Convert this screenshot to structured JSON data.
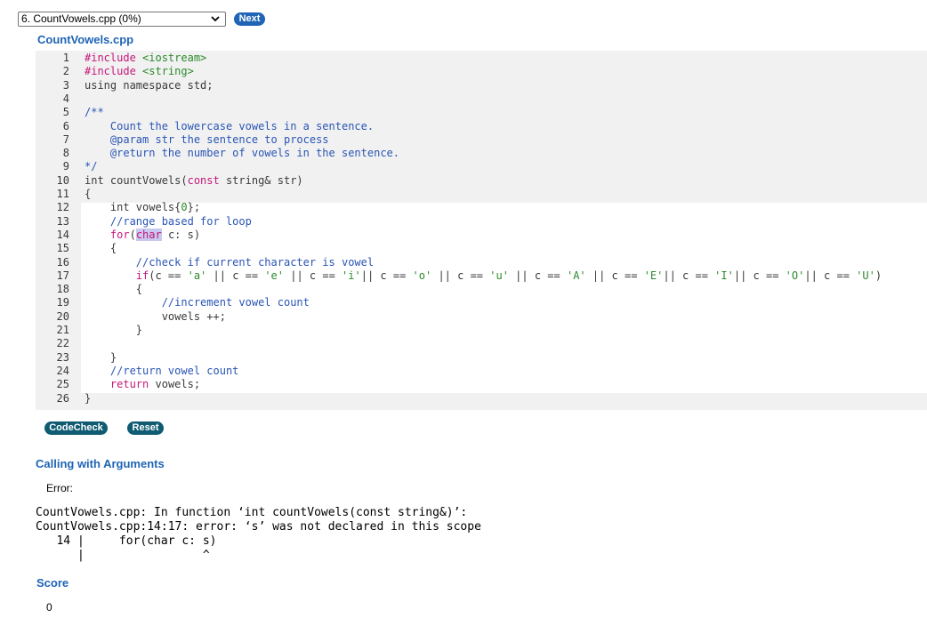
{
  "toolbar": {
    "file_select_value": "6. CountVowels.cpp (0%)",
    "next_label": "Next"
  },
  "editor": {
    "filename": "CountVowels.cpp",
    "lines": [
      {
        "n": "1",
        "text": "#include <iostream>"
      },
      {
        "n": "2",
        "text": "#include <string>"
      },
      {
        "n": "3",
        "text": "using namespace std;"
      },
      {
        "n": "4",
        "text": ""
      },
      {
        "n": "5",
        "text": "/**"
      },
      {
        "n": "6",
        "text": "    Count the lowercase vowels in a sentence."
      },
      {
        "n": "7",
        "text": "    @param str the sentence to process"
      },
      {
        "n": "8",
        "text": "    @return the number of vowels in the sentence."
      },
      {
        "n": "9",
        "text": "*/"
      },
      {
        "n": "10",
        "text": "int countVowels(const string& str)"
      },
      {
        "n": "11",
        "text": "{"
      },
      {
        "n": "12",
        "text": "    int vowels{0};"
      },
      {
        "n": "13",
        "text": "    //range based for loop"
      },
      {
        "n": "14",
        "text": "    for(char c: s)"
      },
      {
        "n": "15",
        "text": "    {"
      },
      {
        "n": "16",
        "text": "        //check if current character is vowel"
      },
      {
        "n": "17",
        "text": "        if(c == 'a' || c == 'e' || c == 'i'|| c == 'o' || c == 'u' || c == 'A' || c == 'E'|| c == 'I'|| c == 'O'|| c == 'U')"
      },
      {
        "n": "18",
        "text": "        {"
      },
      {
        "n": "19",
        "text": "            //increment vowel count"
      },
      {
        "n": "20",
        "text": "            vowels ++;"
      },
      {
        "n": "21",
        "text": "        }"
      },
      {
        "n": "22",
        "text": ""
      },
      {
        "n": "23",
        "text": "    }"
      },
      {
        "n": "24",
        "text": "    //return vowel count"
      },
      {
        "n": "25",
        "text": "    return vowels;"
      },
      {
        "n": "26",
        "text": "}"
      }
    ]
  },
  "actions": {
    "codecheck_label": "CodeCheck",
    "reset_label": "Reset"
  },
  "results": {
    "calling_title": "Calling with Arguments",
    "error_label": "Error:",
    "error_output": "CountVowels.cpp: In function ‘int countVowels(const string&)’:\nCountVowels.cpp:14:17: error: ‘s’ was not declared in this scope\n   14 |     for(char c: s)\n      |                 ^",
    "score_title": "Score",
    "score_value": "0"
  },
  "colors": {
    "accent_blue": "#1f64b5",
    "teal_button": "#0f5b72",
    "keyword": "#c6177a",
    "string": "#2b8a2b",
    "comment": "#2a55b5",
    "code_bg_readonly": "#f1f1f1",
    "code_bg_editable": "#ffffff"
  }
}
